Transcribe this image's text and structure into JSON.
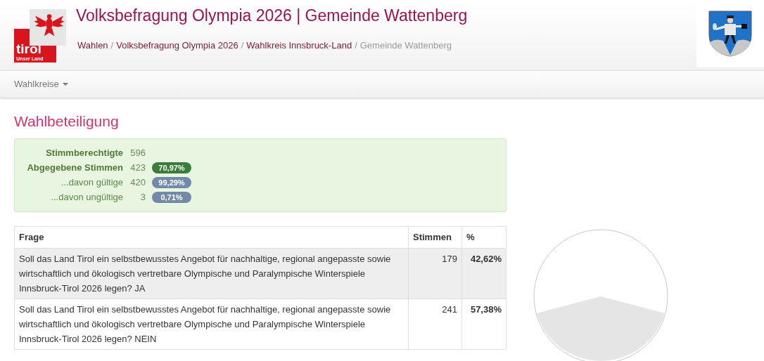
{
  "header": {
    "logo": {
      "word": "tirol",
      "tagline": "Unser Land"
    },
    "title": "Volksbefragung Olympia 2026 | Gemeinde Wattenberg",
    "breadcrumb_separator": "/",
    "breadcrumb": [
      {
        "label": "Wahlen",
        "current": false
      },
      {
        "label": "Volksbefragung Olympia 2026",
        "current": false
      },
      {
        "label": "Wahlkreis Innsbruck-Land",
        "current": false
      },
      {
        "label": "Gemeinde Wattenberg",
        "current": true
      }
    ]
  },
  "navbar": {
    "menu": "Wahlkreise"
  },
  "section_title": "Wahlbeteiligung",
  "turnout": [
    {
      "label": "Stimmberechtigte",
      "value": "596",
      "emphasis": true
    },
    {
      "label": "Abgegebene Stimmen",
      "value": "423",
      "emphasis": true,
      "badge": "70,97%",
      "color": "#3a7d3a"
    },
    {
      "label": "...davon gültige",
      "value": "420",
      "emphasis": false,
      "badge": "99,29%",
      "color": "#7289a8"
    },
    {
      "label": "...davon ungültige",
      "value": "3",
      "emphasis": false,
      "badge": "0,71%",
      "color": "#7289a8"
    }
  ],
  "table": {
    "columns": [
      "Frage",
      "Stimmen",
      "%"
    ],
    "rows": [
      {
        "question": "Soll das Land Tirol ein selbstbewusstes Angebot für nachhaltige, regional angepasste sowie wirtschaftlich und ökologisch vertretbare Olympische und Paralympische Winterspiele Innsbruck-Tirol 2026 legen? JA",
        "votes": "179",
        "percent": "42,62%",
        "highlighted": true
      },
      {
        "question": "Soll das Land Tirol ein selbstbewusstes Angebot für nachhaltige, regional angepasste sowie wirtschaftlich und ökologisch vertretbare Olympische und Paralympische Winterspiele Innsbruck-Tirol 2026 legen? NEIN",
        "votes": "241",
        "percent": "57,38%",
        "highlighted": false
      }
    ]
  }
}
